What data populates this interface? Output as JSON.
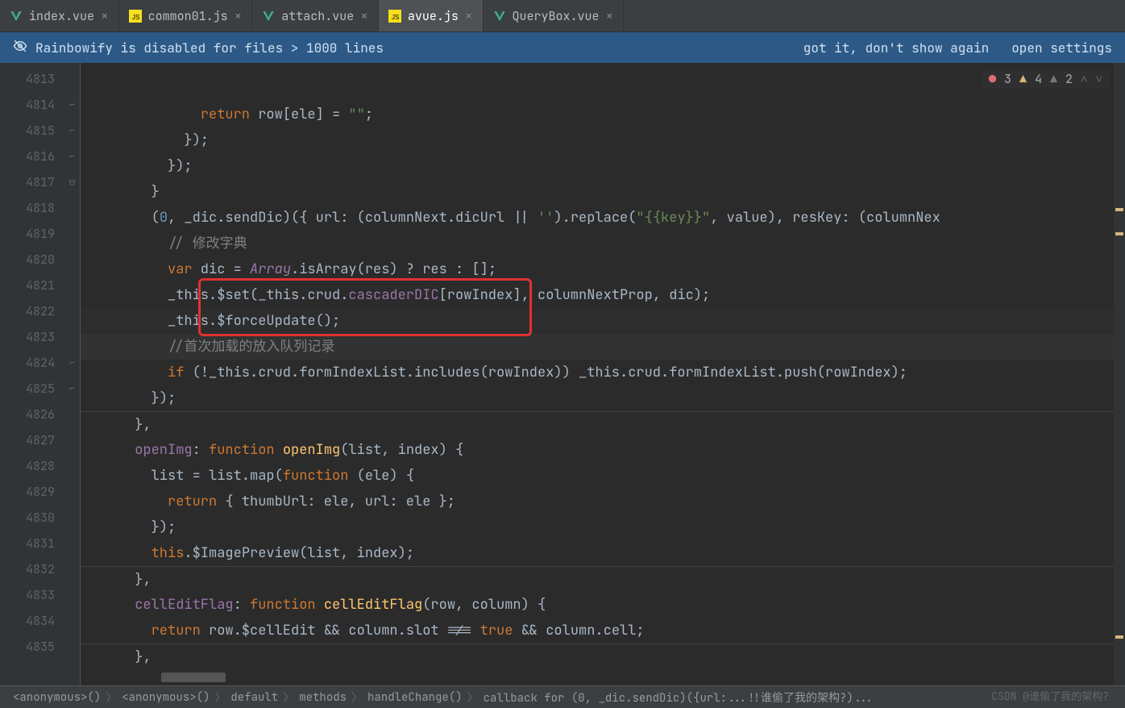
{
  "tabs": [
    {
      "label": "index.vue",
      "icon": "vue",
      "active": false
    },
    {
      "label": "common01.js",
      "icon": "js",
      "active": false
    },
    {
      "label": "attach.vue",
      "icon": "vue",
      "active": false
    },
    {
      "label": "avue.js",
      "icon": "js",
      "active": true
    },
    {
      "label": "QueryBox.vue",
      "icon": "vue",
      "active": false
    }
  ],
  "banner": {
    "message": "Rainbowify is disabled for files > 1000 lines",
    "action1": "got it, don't show again",
    "action2": "open settings"
  },
  "inspections": {
    "errors": "3",
    "warnings_strong": "4",
    "warnings_weak": "2"
  },
  "gutter_start": 4813,
  "gutter_end": 4835,
  "current_line": 4822,
  "code_lines": [
    {
      "n": 4813,
      "html": "              <span class='k-orange'>return</span> row[ele] = <span class='k-green'>\"\"</span>;"
    },
    {
      "n": 4814,
      "html": "            });",
      "fold": "end"
    },
    {
      "n": 4815,
      "html": "          });",
      "fold": "end"
    },
    {
      "n": 4816,
      "html": "        }",
      "fold": "end"
    },
    {
      "n": 4817,
      "html": "        (<span class='k-num'>0</span>, _dic.sendDic)({ url: (columnNext.dicUrl || <span class='k-green'>''</span>).replace(<span class='k-green'>\"{{key}}\"</span>, value), resKey: (columnNex",
      "fold": "start"
    },
    {
      "n": 4818,
      "html": "          <span class='k-grey'>// 修改字典</span>"
    },
    {
      "n": 4819,
      "html": "          <span class='k-orange'>var</span> dic = <span class='k-purple k-ital'>Array</span>.isArray(res) ? res : [];"
    },
    {
      "n": 4820,
      "html": "          _this.$set(_this.crud.<span class='k-purple'>cascaderDIC</span>[rowIndex], columnNextProp, dic);"
    },
    {
      "n": 4821,
      "html": "          _this.$forceUpdate();",
      "hl": true
    },
    {
      "n": 4822,
      "html": "          <span class='k-grey'>//首次加载的放入队列记录</span>",
      "current": true
    },
    {
      "n": 4823,
      "html": "          <span class='k-orange'>if</span> (!_this.crud.formIndexList.includes(rowIndex)) _this.crud.formIndexList.push(rowIndex);"
    },
    {
      "n": 4824,
      "html": "        });",
      "fold": "end"
    },
    {
      "n": 4825,
      "html": "      },",
      "fold": "end",
      "sep": true
    },
    {
      "n": 4826,
      "html": "      <span class='k-purple'>openImg</span>: <span class='k-orange'>function</span> <span class='k-yellow'>openImg</span>(list, index) {"
    },
    {
      "n": 4827,
      "html": "        list = list.map(<span class='k-orange'>function</span> (ele) {"
    },
    {
      "n": 4828,
      "html": "          <span class='k-orange'>return</span> { thumbUrl: ele, url: ele };"
    },
    {
      "n": 4829,
      "html": "        });"
    },
    {
      "n": 4830,
      "html": "        <span class='k-orange'>this</span>.$ImagePreview(list, index);"
    },
    {
      "n": 4831,
      "html": "      },",
      "sep": true
    },
    {
      "n": 4832,
      "html": "      <span class='k-purple'>cellEditFlag</span>: <span class='k-orange'>function</span> <span class='k-yellow'>cellEditFlag</span>(row, column) {"
    },
    {
      "n": 4833,
      "html": "        <span class='k-orange'>return</span> row.$cellEdit && column.slot !== <span class='k-orange'>true</span> && column.cell;"
    },
    {
      "n": 4834,
      "html": "      },",
      "sep": true
    },
    {
      "n": 4835,
      "html": ""
    }
  ],
  "breadcrumb": [
    "<anonymous>()",
    "<anonymous>()",
    "default",
    "methods",
    "handleChange()",
    "callback for (0, _dic.sendDic)({url:...!!谁偷了我的架构?)..."
  ],
  "watermark": "CSDN @谁偷了我的架构?"
}
